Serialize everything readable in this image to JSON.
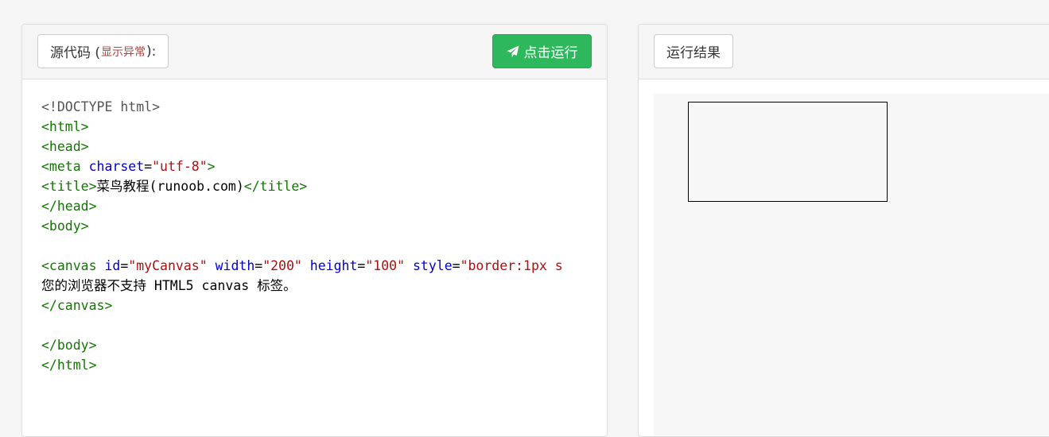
{
  "editor": {
    "label_main": "源代码 (",
    "label_warn": "显示异常",
    "label_tail": "):",
    "run_button": "点击运行",
    "run_icon": "paper-plane-icon"
  },
  "code_lines": [
    [
      {
        "t": "doc",
        "v": "<!DOCTYPE html>"
      }
    ],
    [
      {
        "t": "tag",
        "v": "<html>"
      }
    ],
    [
      {
        "t": "tag",
        "v": "<head>"
      }
    ],
    [
      {
        "t": "tag",
        "v": "<meta "
      },
      {
        "t": "attr",
        "v": "charset"
      },
      {
        "t": "txt",
        "v": "="
      },
      {
        "t": "str",
        "v": "\"utf-8\""
      },
      {
        "t": "tag",
        "v": ">"
      }
    ],
    [
      {
        "t": "tag",
        "v": "<title>"
      },
      {
        "t": "txt",
        "v": "菜鸟教程(runoob.com)"
      },
      {
        "t": "tag",
        "v": "</title>"
      }
    ],
    [
      {
        "t": "tag",
        "v": "</head>"
      }
    ],
    [
      {
        "t": "tag",
        "v": "<body>"
      }
    ],
    [],
    [
      {
        "t": "tag",
        "v": "<canvas "
      },
      {
        "t": "attr",
        "v": "id"
      },
      {
        "t": "txt",
        "v": "="
      },
      {
        "t": "str",
        "v": "\"myCanvas\""
      },
      {
        "t": "txt",
        "v": " "
      },
      {
        "t": "attr",
        "v": "width"
      },
      {
        "t": "txt",
        "v": "="
      },
      {
        "t": "str",
        "v": "\"200\""
      },
      {
        "t": "txt",
        "v": " "
      },
      {
        "t": "attr",
        "v": "height"
      },
      {
        "t": "txt",
        "v": "="
      },
      {
        "t": "str",
        "v": "\"100\""
      },
      {
        "t": "txt",
        "v": " "
      },
      {
        "t": "attr",
        "v": "style"
      },
      {
        "t": "txt",
        "v": "="
      },
      {
        "t": "str",
        "v": "\"border:1px s"
      }
    ],
    [
      {
        "t": "txt",
        "v": "您的浏览器不支持 HTML5 canvas 标签。"
      }
    ],
    [
      {
        "t": "tag",
        "v": "</canvas>"
      }
    ],
    [],
    [
      {
        "t": "tag",
        "v": "</body>"
      }
    ],
    [
      {
        "t": "tag",
        "v": "</html>"
      }
    ]
  ],
  "result": {
    "label": "运行结果"
  },
  "colors": {
    "run_button": "#2db85c",
    "tag": "#117700",
    "attr": "#0000cc",
    "string": "#aa1111",
    "doctype": "#555555",
    "warn": "#a94442"
  }
}
